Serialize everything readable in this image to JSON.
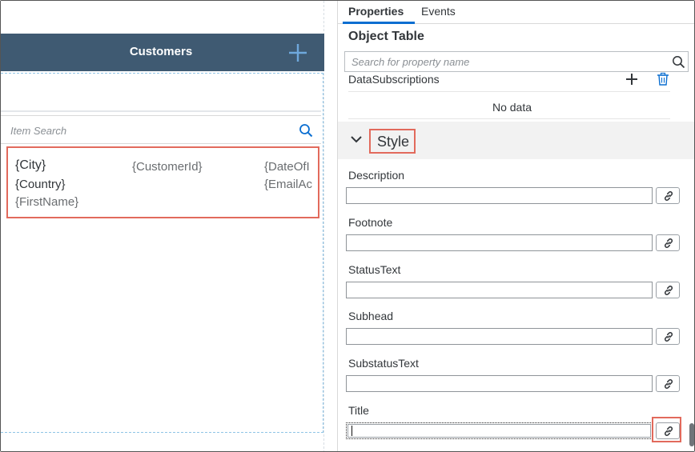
{
  "preview": {
    "header_title": "Customers",
    "add_icon": "plus-icon",
    "item_search_placeholder": "Item Search",
    "search_icon": "search-icon",
    "record": {
      "city": "{City}",
      "customer_id": "{CustomerId}",
      "date_of": "{DateOfI",
      "country": "{Country}",
      "email": "{EmailAc",
      "first_name": "{FirstName}"
    }
  },
  "properties": {
    "tabs": [
      {
        "label": "Properties",
        "active": true
      },
      {
        "label": "Events",
        "active": false
      }
    ],
    "object_title": "Object Table",
    "search_placeholder": "Search for property name",
    "data_subscriptions": {
      "label": "DataSubscriptions",
      "empty_text": "No data",
      "add_icon": "plus-icon",
      "delete_icon": "trash-icon"
    },
    "style_section": {
      "label": "Style",
      "expanded": true,
      "chevron_icon": "chevron-down-icon"
    },
    "fields": [
      {
        "label": "Description",
        "value": ""
      },
      {
        "label": "Footnote",
        "value": ""
      },
      {
        "label": "StatusText",
        "value": ""
      },
      {
        "label": "Subhead",
        "value": ""
      },
      {
        "label": "SubstatusText",
        "value": ""
      },
      {
        "label": "Title",
        "value": ""
      }
    ],
    "bind_icon": "link-icon"
  },
  "colors": {
    "header_bar": "#3f5a72",
    "highlight": "#e26a5c",
    "accent": "#0a6ed1"
  }
}
